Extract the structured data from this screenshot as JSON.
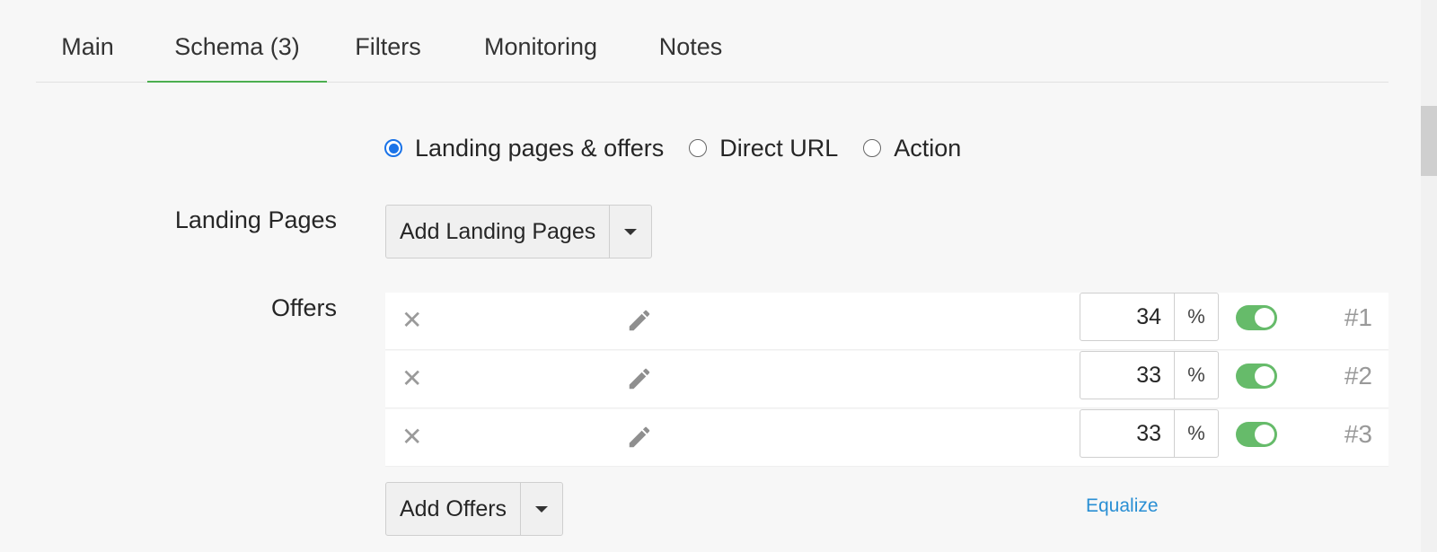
{
  "tabs": [
    {
      "label": "Main",
      "active": false
    },
    {
      "label": "Schema (3)",
      "active": true
    },
    {
      "label": "Filters",
      "active": false
    },
    {
      "label": "Monitoring",
      "active": false
    },
    {
      "label": "Notes",
      "active": false
    }
  ],
  "destination_type": {
    "options": [
      {
        "label": "Landing pages & offers",
        "checked": true
      },
      {
        "label": "Direct URL",
        "checked": false
      },
      {
        "label": "Action",
        "checked": false
      }
    ]
  },
  "landing_pages": {
    "label": "Landing Pages",
    "add_button": "Add Landing Pages"
  },
  "offers": {
    "label": "Offers",
    "rows": [
      {
        "weight": "34",
        "unit": "%",
        "enabled": true,
        "number": "#1"
      },
      {
        "weight": "33",
        "unit": "%",
        "enabled": true,
        "number": "#2"
      },
      {
        "weight": "33",
        "unit": "%",
        "enabled": true,
        "number": "#3"
      }
    ],
    "add_button": "Add Offers",
    "equalize_link": "Equalize"
  },
  "colors": {
    "accent_green": "#4caf50",
    "toggle_on": "#66bb6a",
    "radio_blue": "#1a73e8",
    "link_blue": "#2a8fd4"
  },
  "icons": {
    "remove": "close-icon",
    "edit": "pencil-icon",
    "dropdown": "caret-down-icon"
  }
}
